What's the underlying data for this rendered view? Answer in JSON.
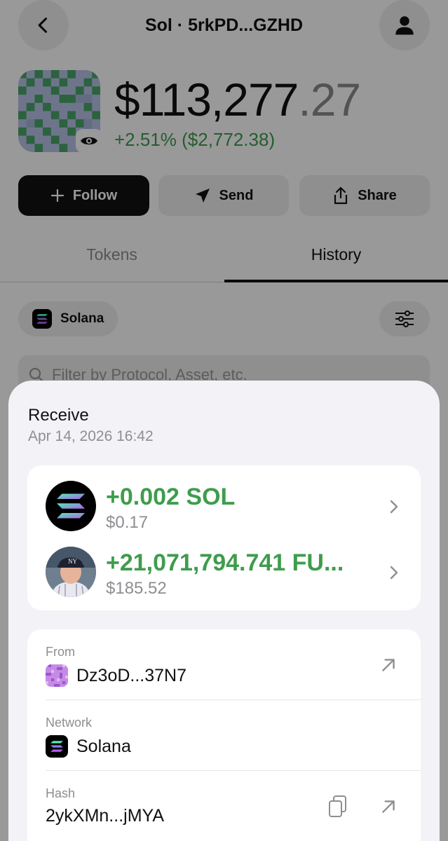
{
  "header": {
    "title": "Sol · 5rkPD...GZHD"
  },
  "wallet": {
    "balance_main": "$113,277",
    "balance_cents": ".27",
    "change": "+2.51% ($2,772.38)"
  },
  "actions": {
    "follow": "Follow",
    "send": "Send",
    "share": "Share"
  },
  "tabs": [
    "Tokens",
    "History"
  ],
  "active_tab": "History",
  "network_chip": "Solana",
  "search": {
    "placeholder": "Filter by Protocol, Asset, etc."
  },
  "sheet": {
    "title": "Receive",
    "date": "Apr 14, 2026 16:42",
    "assets": [
      {
        "amount": "+0.002 SOL",
        "usd": "$0.17",
        "icon": "solana-logo-icon"
      },
      {
        "amount": "+21,071,794.741 FU...",
        "usd": "$185.52",
        "icon": "token-avatar-icon"
      }
    ],
    "details": {
      "from_label": "From",
      "from_value": "Dz3oD...37N7",
      "network_label": "Network",
      "network_value": "Solana",
      "hash_label": "Hash",
      "hash_value": "2ykXMn...jMYA"
    }
  },
  "colors": {
    "positive": "#3f9c4e",
    "muted": "#8e8e93",
    "sheet_bg": "#f2f2f7"
  }
}
